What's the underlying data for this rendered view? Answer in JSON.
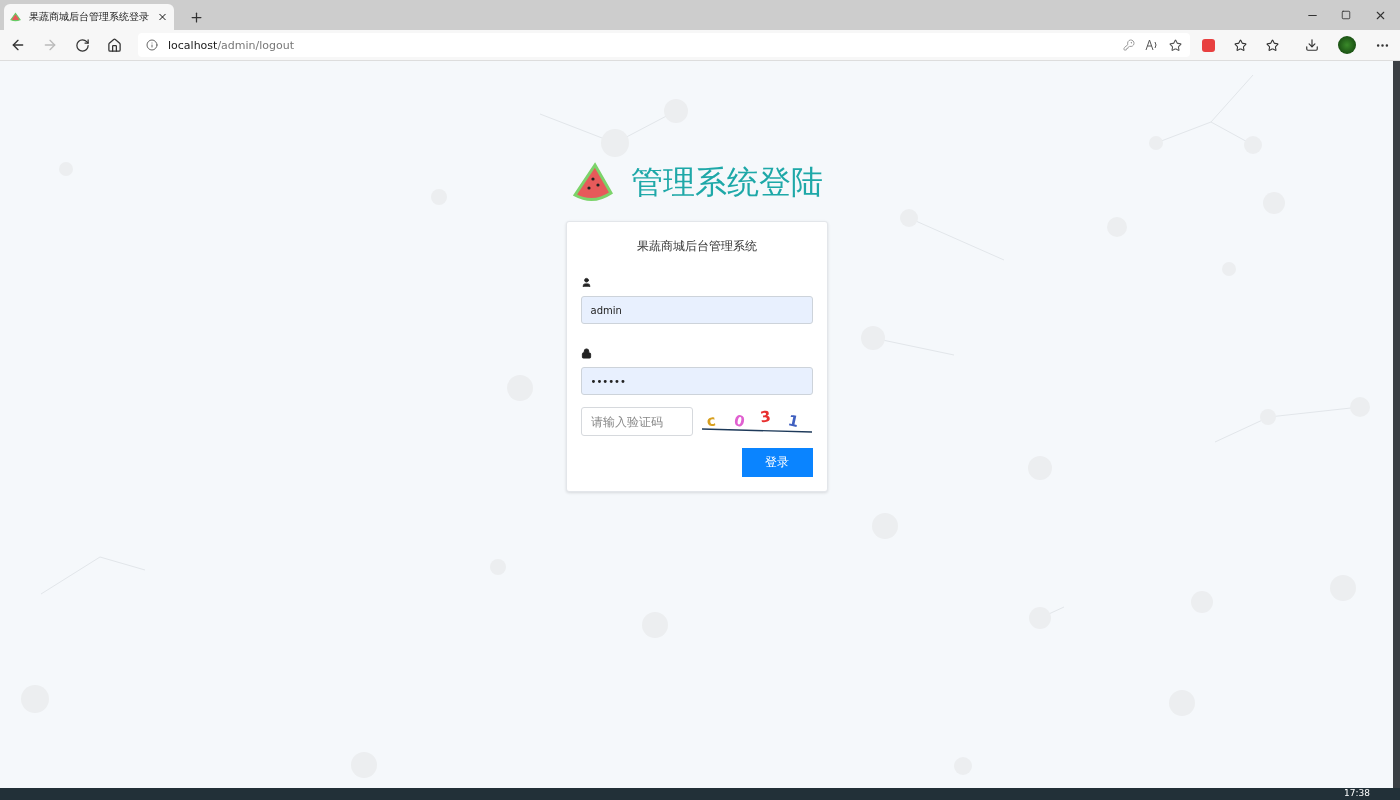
{
  "browser": {
    "tab": {
      "title": "果蔬商城后台管理系统登录",
      "selected": true
    },
    "address": {
      "host": "localhost",
      "path": "/admin/logout"
    }
  },
  "header": {
    "title": "管理系统登陆"
  },
  "login": {
    "subtitle": "果蔬商城后台管理系统",
    "username": "admin",
    "password": "••••••",
    "captcha_placeholder": "请输入验证码",
    "captcha": [
      {
        "char": "c",
        "color": "#d8a020"
      },
      {
        "char": "0",
        "color": "#e060d0"
      },
      {
        "char": "3",
        "color": "#e83030"
      },
      {
        "char": "1",
        "color": "#4060c0"
      }
    ],
    "submit": "登录"
  },
  "taskbar": {
    "clock": "17:38"
  }
}
